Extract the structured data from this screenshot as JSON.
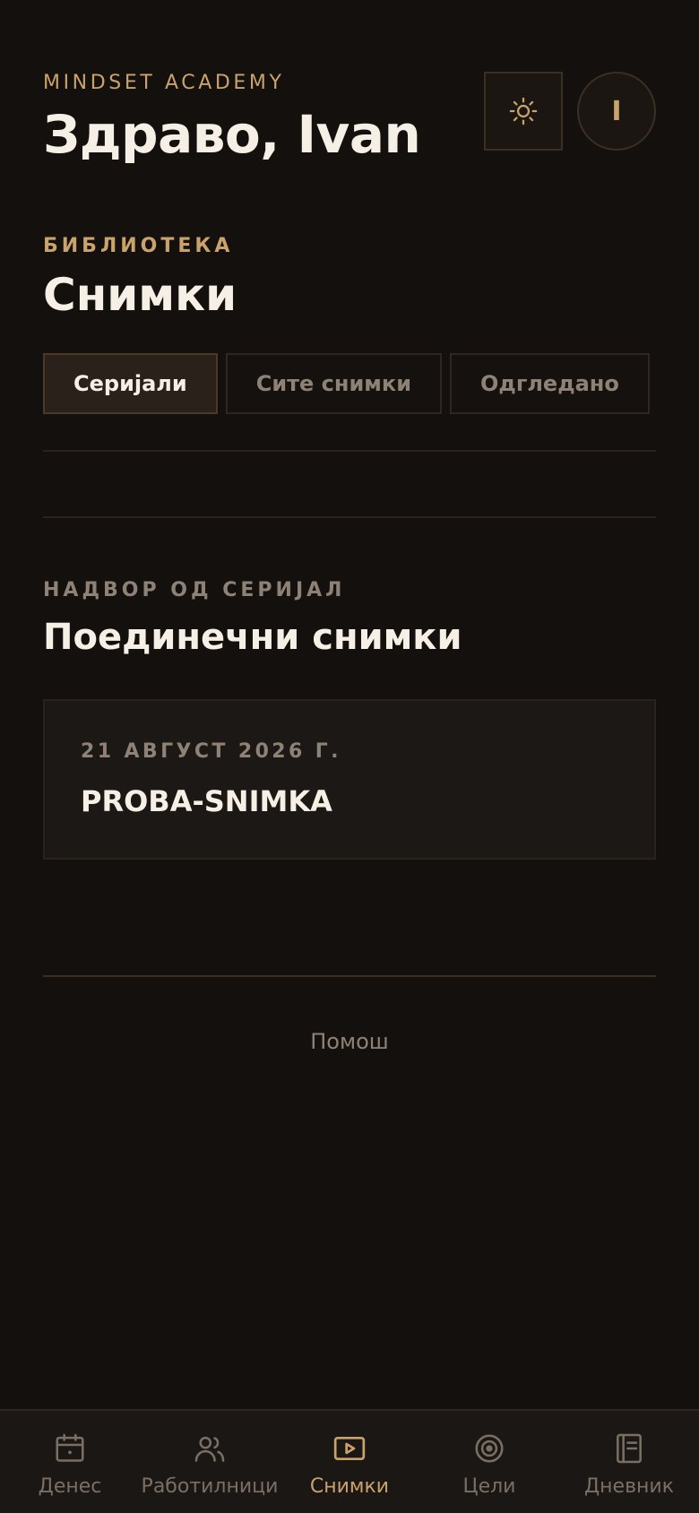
{
  "header": {
    "brand": "MINDSET ACADEMY",
    "greeting": "Здраво, Ivan",
    "avatar_initial": "I"
  },
  "library": {
    "label": "БИБЛИОТЕКА",
    "title": "Снимки",
    "tabs": [
      {
        "label": "Серијали",
        "active": true
      },
      {
        "label": "Сите снимки",
        "active": false
      },
      {
        "label": "Одгледано",
        "active": false
      }
    ]
  },
  "standalone": {
    "label": "НАДВОР ОД СЕРИЈАЛ",
    "title": "Поединечни снимки",
    "items": [
      {
        "date": "21 АВГУСТ 2026 Г.",
        "title": "PROBA-SNIMKA"
      }
    ]
  },
  "footer": {
    "help": "Помош"
  },
  "nav": {
    "items": [
      {
        "label": "Денес",
        "icon": "calendar-icon",
        "active": false
      },
      {
        "label": "Работилници",
        "icon": "users-icon",
        "active": false
      },
      {
        "label": "Снимки",
        "icon": "play-icon",
        "active": true
      },
      {
        "label": "Цели",
        "icon": "target-icon",
        "active": false
      },
      {
        "label": "Дневник",
        "icon": "journal-icon",
        "active": false
      }
    ]
  },
  "colors": {
    "background": "#13100e",
    "accent": "#c9a36b",
    "muted": "#8e8276",
    "text": "#f5efe6"
  }
}
